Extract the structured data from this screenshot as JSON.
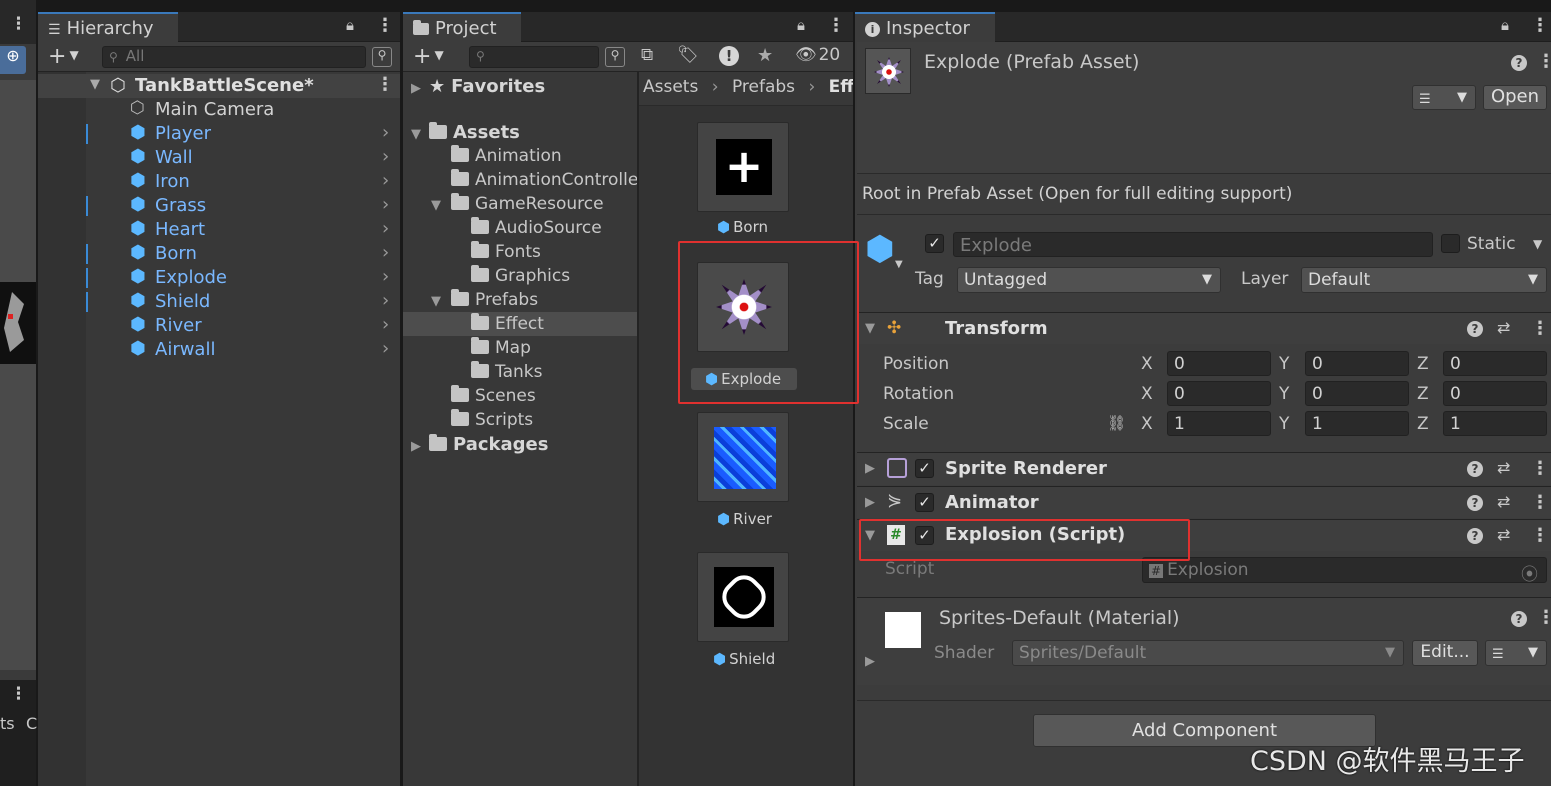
{
  "hierarchy": {
    "tab_label": "Hierarchy",
    "search_placeholder": "All",
    "scene_name": "TankBattleScene*",
    "items": [
      {
        "label": "Main Camera",
        "type": "camera"
      },
      {
        "label": "Player",
        "type": "prefab"
      },
      {
        "label": "Wall",
        "type": "prefab"
      },
      {
        "label": "Iron",
        "type": "prefab"
      },
      {
        "label": "Grass",
        "type": "prefab"
      },
      {
        "label": "Heart",
        "type": "prefab"
      },
      {
        "label": "Born",
        "type": "prefab"
      },
      {
        "label": "Explode",
        "type": "prefab"
      },
      {
        "label": "Shield",
        "type": "prefab"
      },
      {
        "label": "River",
        "type": "prefab"
      },
      {
        "label": "Airwall",
        "type": "prefab"
      }
    ]
  },
  "left_strip": {
    "partial_text": "ts",
    "partial_text2": "C"
  },
  "project": {
    "tab_label": "Project",
    "hidden_count": "20",
    "breadcrumb": [
      "Assets",
      "Prefabs",
      "Effe"
    ],
    "tree": {
      "favorites": "Favorites",
      "assets": "Assets",
      "animation": "Animation",
      "animation_controller": "AnimationControlle",
      "game_resource": "GameResource",
      "audio_source": "AudioSource",
      "fonts": "Fonts",
      "graphics": "Graphics",
      "prefabs": "Prefabs",
      "effect": "Effect",
      "map": "Map",
      "tanks": "Tanks",
      "scenes": "Scenes",
      "scripts": "Scripts",
      "packages": "Packages"
    },
    "grid_items": [
      "Born",
      "Explode",
      "River",
      "Shield"
    ]
  },
  "inspector": {
    "tab_label": "Inspector",
    "title": "Explode (Prefab Asset)",
    "open_button": "Open",
    "root_note": "Root in Prefab Asset (Open for full editing support)",
    "object_name": "Explode",
    "static_label": "Static",
    "tag_label": "Tag",
    "tag_value": "Untagged",
    "layer_label": "Layer",
    "layer_value": "Default",
    "transform": {
      "title": "Transform",
      "position_label": "Position",
      "rotation_label": "Rotation",
      "scale_label": "Scale",
      "position": {
        "x": "0",
        "y": "0",
        "z": "0"
      },
      "rotation": {
        "x": "0",
        "y": "0",
        "z": "0"
      },
      "scale": {
        "x": "1",
        "y": "1",
        "z": "1"
      },
      "axis_x": "X",
      "axis_y": "Y",
      "axis_z": "Z"
    },
    "sprite_renderer": "Sprite Renderer",
    "animator": "Animator",
    "explosion_script": "Explosion (Script)",
    "script_label": "Script",
    "script_value": "Explosion",
    "material_title": "Sprites-Default (Material)",
    "shader_label": "Shader",
    "shader_value": "Sprites/Default",
    "edit_button": "Edit...",
    "add_component": "Add Component"
  },
  "watermark": "CSDN @软件黑马王子",
  "colors": {
    "highlight": "#e0312f",
    "prefab_blue": "#5cb8ff",
    "selection": "#3a79bb"
  }
}
